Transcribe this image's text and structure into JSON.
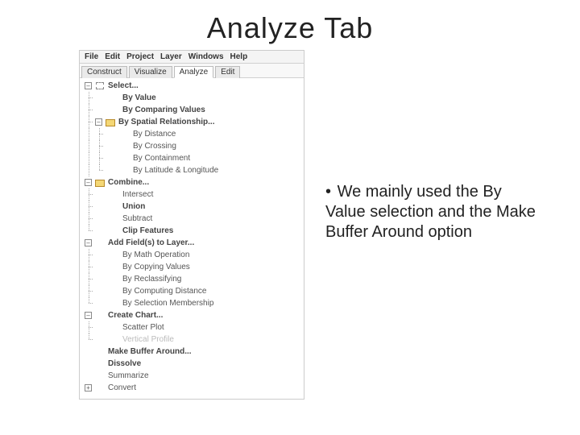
{
  "slide": {
    "title": "Analyze Tab",
    "bullet": "We mainly used the By Value selection and the Make Buffer Around option"
  },
  "menubar": {
    "file": "File",
    "edit": "Edit",
    "project": "Project",
    "layer": "Layer",
    "windows": "Windows",
    "help": "Help"
  },
  "tabs": {
    "construct": "Construct",
    "visualize": "Visualize",
    "analyze": "Analyze",
    "edit": "Edit",
    "active": "analyze"
  },
  "tree": {
    "select": {
      "label": "Select...",
      "by_value": "By Value",
      "by_comparing": "By Comparing Values",
      "spatial": {
        "label": "By Spatial Relationship...",
        "by_distance": "By Distance",
        "by_crossing": "By Crossing",
        "by_containment": "By Containment",
        "by_latlon": "By Latitude & Longitude"
      }
    },
    "combine": {
      "label": "Combine...",
      "intersect": "Intersect",
      "union": "Union",
      "subtract": "Subtract",
      "clip": "Clip Features"
    },
    "addfields": {
      "label": "Add Field(s) to Layer...",
      "math": "By Math Operation",
      "copy": "By Copying Values",
      "reclass": "By Reclassifying",
      "distance": "By Computing Distance",
      "selmember": "By Selection Membership"
    },
    "chart": {
      "label": "Create Chart...",
      "scatter": "Scatter Plot",
      "profile": "Vertical Profile"
    },
    "buffer": "Make Buffer Around...",
    "dissolve": "Dissolve",
    "summarize": "Summarize",
    "convert": "Convert"
  }
}
